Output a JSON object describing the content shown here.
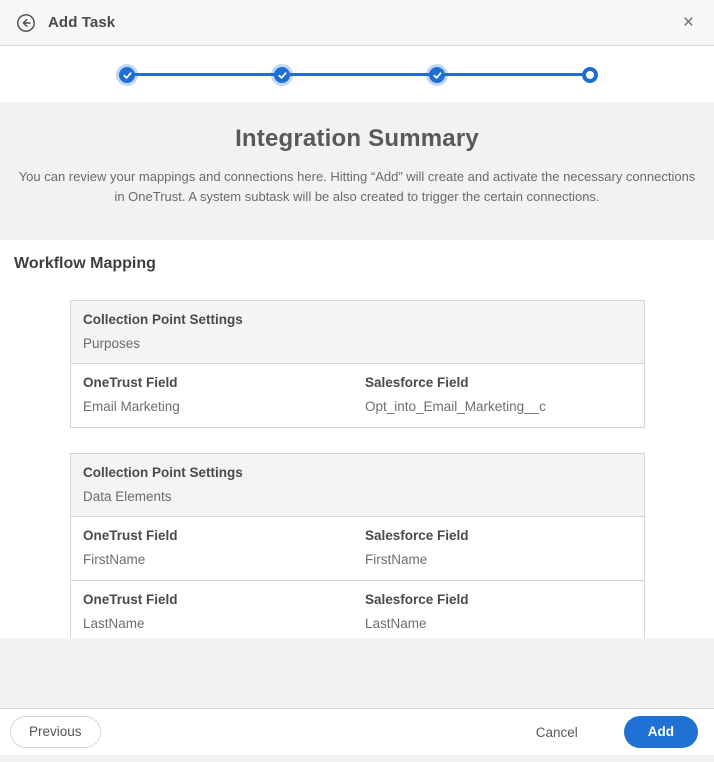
{
  "dialog": {
    "title": "Add Task",
    "close_glyph": "×"
  },
  "stepper": {
    "steps": [
      {
        "index": 1,
        "state": "complete"
      },
      {
        "index": 2,
        "state": "complete"
      },
      {
        "index": 3,
        "state": "complete"
      },
      {
        "index": 4,
        "state": "current"
      }
    ]
  },
  "summary": {
    "title": "Integration Summary",
    "description": "You can review your mappings and connections here. Hitting “Add” will create and activate the necessary connections in OneTrust. A system subtask will be also created to trigger the certain connections."
  },
  "workflow": {
    "heading": "Workflow Mapping",
    "cards": [
      {
        "header_title": "Collection Point Settings",
        "header_subtitle": "Purposes",
        "rows": [
          {
            "onetrust_label": "OneTrust Field",
            "onetrust_value": "Email Marketing",
            "salesforce_label": "Salesforce Field",
            "salesforce_value": "Opt_into_Email_Marketing__c"
          }
        ]
      },
      {
        "header_title": "Collection Point Settings",
        "header_subtitle": "Data Elements",
        "rows": [
          {
            "onetrust_label": "OneTrust Field",
            "onetrust_value": "FirstName",
            "salesforce_label": "Salesforce Field",
            "salesforce_value": "FirstName"
          },
          {
            "onetrust_label": "OneTrust Field",
            "onetrust_value": "LastName",
            "salesforce_label": "Salesforce Field",
            "salesforce_value": "LastName"
          }
        ]
      }
    ]
  },
  "footer": {
    "previous_label": "Previous",
    "cancel_label": "Cancel",
    "add_label": "Add"
  },
  "colors": {
    "accent_blue": "#1f6ed4",
    "button_blue": "#2071d4",
    "header_bg": "#f7f7f8",
    "section_bg": "#f2f2f3",
    "border": "#d5d5d5"
  }
}
